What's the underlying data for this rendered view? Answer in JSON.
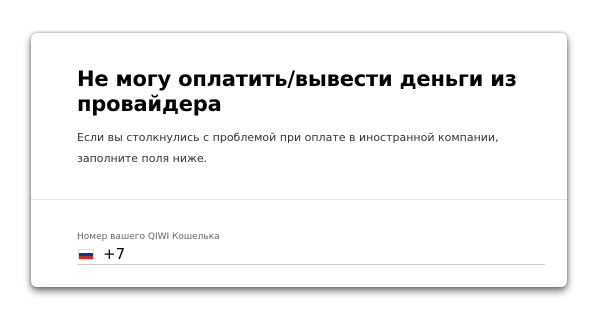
{
  "form": {
    "title": "Не могу оплатить/вывести деньги из провайдера",
    "description": "Если вы столкнулись с проблемой при оплате в иностранной компании, заполните поля ниже.",
    "wallet_field": {
      "label": "Номер вашего QIWI Кошелька",
      "country_icon": "russia-flag-icon",
      "flag_colors": [
        "#ffffff",
        "#0039a6",
        "#d52b1e"
      ],
      "value": "+7"
    }
  }
}
